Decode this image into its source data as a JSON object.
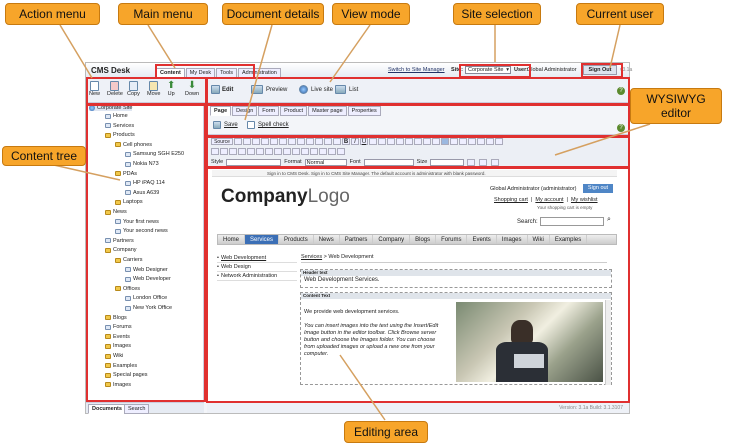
{
  "callouts": {
    "action_menu": "Action menu",
    "main_menu": "Main menu",
    "document_details": "Document details",
    "view_mode": "View mode",
    "site_selection": "Site selection",
    "current_user": "Current user",
    "wysiwyg_editor": "WYSIWYG\neditor",
    "content_tree": "Content tree",
    "editing_area": "Editing area"
  },
  "header": {
    "logo": "CMS Desk",
    "tabs": [
      "Content",
      "My Desk",
      "Tools",
      "Administration"
    ],
    "switch_link": "Switch to Site Manager",
    "site_label": "Site:",
    "site_value": "Corporate Site",
    "user_label": "User:",
    "user_value": "Global Administrator",
    "signout": "Sign Out",
    "version": "v3.1a"
  },
  "actions": [
    "New",
    "Delete",
    "Copy",
    "Move",
    "Up",
    "Down"
  ],
  "view_modes": [
    "Edit",
    "Preview",
    "Live site",
    "List"
  ],
  "tree": {
    "root": "Corporate Site",
    "items": [
      {
        "label": "Home",
        "level": 1,
        "type": "doc"
      },
      {
        "label": "Services",
        "level": 1,
        "type": "doc"
      },
      {
        "label": "Products",
        "level": 1,
        "type": "folder"
      },
      {
        "label": "Cell phones",
        "level": 2,
        "type": "folder"
      },
      {
        "label": "Samsung SGH E250",
        "level": 3,
        "type": "doc"
      },
      {
        "label": "Nokia N73",
        "level": 3,
        "type": "doc"
      },
      {
        "label": "PDAs",
        "level": 2,
        "type": "folder"
      },
      {
        "label": "HP iPAQ 114",
        "level": 3,
        "type": "doc"
      },
      {
        "label": "Asus A639",
        "level": 3,
        "type": "doc"
      },
      {
        "label": "Laptops",
        "level": 2,
        "type": "folder"
      },
      {
        "label": "News",
        "level": 1,
        "type": "folder"
      },
      {
        "label": "Your first news",
        "level": 2,
        "type": "doc"
      },
      {
        "label": "Your second news",
        "level": 2,
        "type": "doc"
      },
      {
        "label": "Partners",
        "level": 1,
        "type": "doc"
      },
      {
        "label": "Company",
        "level": 1,
        "type": "folder"
      },
      {
        "label": "Carriers",
        "level": 2,
        "type": "folder"
      },
      {
        "label": "Web Designer",
        "level": 3,
        "type": "doc"
      },
      {
        "label": "Web Developer",
        "level": 3,
        "type": "doc"
      },
      {
        "label": "Offices",
        "level": 2,
        "type": "folder"
      },
      {
        "label": "London Office",
        "level": 3,
        "type": "doc"
      },
      {
        "label": "New York Office",
        "level": 3,
        "type": "doc"
      },
      {
        "label": "Blogs",
        "level": 1,
        "type": "folder"
      },
      {
        "label": "Forums",
        "level": 1,
        "type": "doc"
      },
      {
        "label": "Events",
        "level": 1,
        "type": "folder"
      },
      {
        "label": "Images",
        "level": 1,
        "type": "folder"
      },
      {
        "label": "Wiki",
        "level": 1,
        "type": "folder"
      },
      {
        "label": "Examples",
        "level": 1,
        "type": "folder"
      },
      {
        "label": "Special pages",
        "level": 1,
        "type": "folder"
      },
      {
        "label": "Images",
        "level": 1,
        "type": "folder"
      }
    ],
    "bottom_tabs": [
      "Documents",
      "Search"
    ]
  },
  "doc_tabs": [
    "Page",
    "Design",
    "Form",
    "Product",
    "Master page",
    "Properties"
  ],
  "doc_actions": {
    "save": "Save",
    "spell": "Spell check"
  },
  "editor": {
    "source": "Source",
    "style_label": "Style",
    "format_label": "Format",
    "format_value": "Normal",
    "font_label": "Font",
    "size_label": "Size"
  },
  "site": {
    "notice_pre": "Sign in to",
    "notice_link1": "CMS Desk",
    "notice_mid": ". Sign in to",
    "notice_link2": "CMS Site Manager",
    "notice_post": ". The default account is administrator with blank password.",
    "logo_company": "Company",
    "logo_logo": "Logo",
    "user_line": "Global Administrator (administrator)",
    "signout": "Sign out",
    "cart": "Shopping cart",
    "account": "My account",
    "wishlist": "My wishlist",
    "cart_empty": "Your shopping cart is empty",
    "search_label": "Search:",
    "menu": [
      "Home",
      "Services",
      "Products",
      "News",
      "Partners",
      "Company",
      "Blogs",
      "Forums",
      "Events",
      "Images",
      "Wiki",
      "Examples"
    ],
    "left_links": [
      "Web Development",
      "Web Design",
      "Network Administration"
    ],
    "breadcrumb_link": "Services",
    "breadcrumb_current": " > Web Development",
    "header_text_label": "Header text",
    "header_text_value": "Web Development Services.",
    "content_text_label": "Content Text",
    "content_p1": "We provide web development services.",
    "content_p2": "You can insert images into the text using the Insert/Edit Image button in the editor toolbar. Click Browse server button and choose the Images folder. You can choose from uploaded images or upload a new one from your computer."
  },
  "footer_version": "Version: 3.1a Build: 3.1.3107"
}
